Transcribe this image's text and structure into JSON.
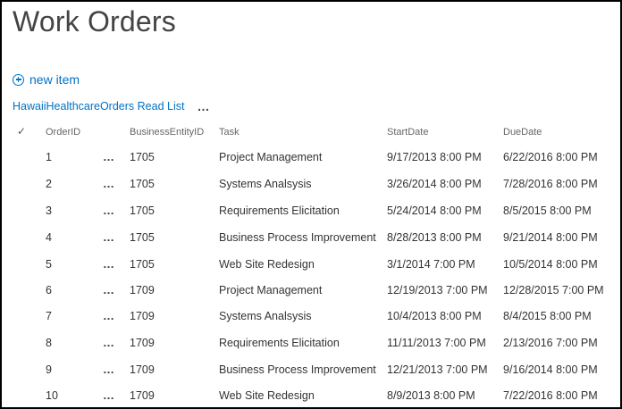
{
  "page": {
    "title": "Work Orders"
  },
  "toolbar": {
    "new_item_label": "new item"
  },
  "view": {
    "name": "HawaiiHealthcareOrders Read List",
    "menu_label": "…"
  },
  "table": {
    "columns": [
      "OrderID",
      "BusinessEntityID",
      "Task",
      "StartDate",
      "DueDate"
    ],
    "rows": [
      {
        "OrderID": "1",
        "BusinessEntityID": "1705",
        "Task": "Project Management",
        "StartDate": "9/17/2013 8:00 PM",
        "DueDate": "6/22/2016 8:00 PM"
      },
      {
        "OrderID": "2",
        "BusinessEntityID": "1705",
        "Task": "Systems Analsysis",
        "StartDate": "3/26/2014 8:00 PM",
        "DueDate": "7/28/2016 8:00 PM"
      },
      {
        "OrderID": "3",
        "BusinessEntityID": "1705",
        "Task": "Requirements Elicitation",
        "StartDate": "5/24/2014 8:00 PM",
        "DueDate": "8/5/2015 8:00 PM"
      },
      {
        "OrderID": "4",
        "BusinessEntityID": "1705",
        "Task": "Business Process Improvement",
        "StartDate": "8/28/2013 8:00 PM",
        "DueDate": "9/21/2014 8:00 PM"
      },
      {
        "OrderID": "5",
        "BusinessEntityID": "1705",
        "Task": "Web Site Redesign",
        "StartDate": "3/1/2014 7:00 PM",
        "DueDate": "10/5/2014 8:00 PM"
      },
      {
        "OrderID": "6",
        "BusinessEntityID": "1709",
        "Task": "Project Management",
        "StartDate": "12/19/2013 7:00 PM",
        "DueDate": "12/28/2015 7:00 PM"
      },
      {
        "OrderID": "7",
        "BusinessEntityID": "1709",
        "Task": "Systems Analsysis",
        "StartDate": "10/4/2013 8:00 PM",
        "DueDate": "8/4/2015 8:00 PM"
      },
      {
        "OrderID": "8",
        "BusinessEntityID": "1709",
        "Task": "Requirements Elicitation",
        "StartDate": "11/11/2013 7:00 PM",
        "DueDate": "2/13/2016 7:00 PM"
      },
      {
        "OrderID": "9",
        "BusinessEntityID": "1709",
        "Task": "Business Process Improvement",
        "StartDate": "12/21/2013 7:00 PM",
        "DueDate": "9/16/2014 8:00 PM"
      },
      {
        "OrderID": "10",
        "BusinessEntityID": "1709",
        "Task": "Web Site Redesign",
        "StartDate": "8/9/2013 8:00 PM",
        "DueDate": "7/22/2016 8:00 PM"
      }
    ],
    "row_menu_label": "…"
  },
  "colors": {
    "link": "#0072c6",
    "text": "#333333",
    "header": "#666666",
    "border": "#000000"
  },
  "icons": {
    "new_item": "plus-circle-icon",
    "select_all": "checkmark-icon",
    "row_menu": "ellipsis-icon"
  }
}
